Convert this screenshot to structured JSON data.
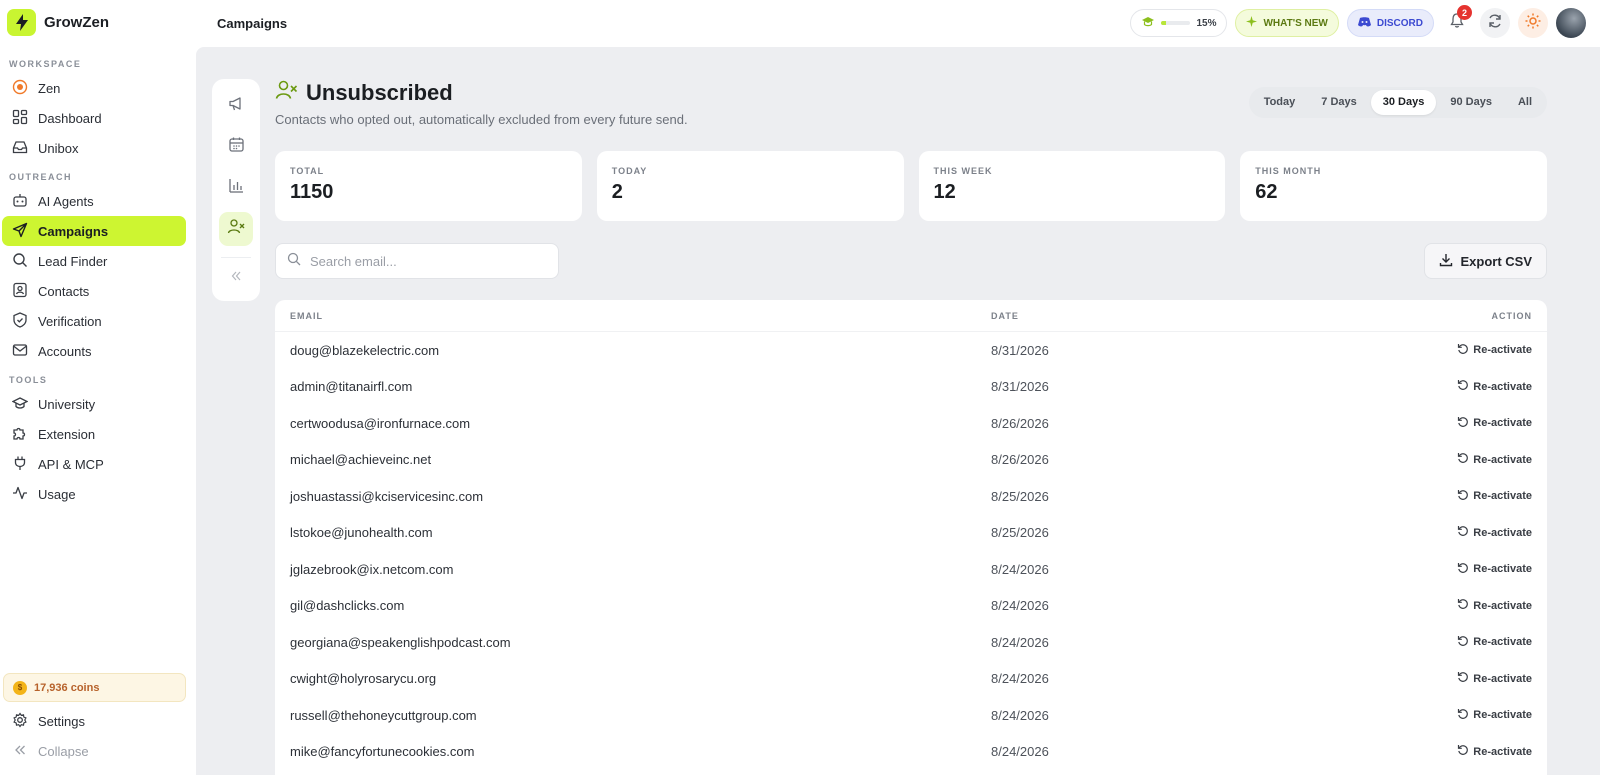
{
  "app": {
    "name": "GrowZen",
    "breadcrumb": "Campaigns"
  },
  "topbar": {
    "progress_label": "15%",
    "progress_value": 0.15,
    "whats_new_label": "WHAT'S NEW",
    "discord_label": "DISCORD",
    "notification_count": "2"
  },
  "sidebar": {
    "sections": {
      "workspace": "WORKSPACE",
      "outreach": "OUTREACH",
      "tools": "TOOLS"
    },
    "workspace_items": [
      {
        "label": "Zen",
        "icon": "target-icon"
      },
      {
        "label": "Dashboard",
        "icon": "grid-icon"
      },
      {
        "label": "Unibox",
        "icon": "inbox-icon"
      }
    ],
    "outreach_items": [
      {
        "label": "AI Agents",
        "icon": "bot-icon"
      },
      {
        "label": "Campaigns",
        "icon": "send-icon"
      },
      {
        "label": "Lead Finder",
        "icon": "search-icon"
      },
      {
        "label": "Contacts",
        "icon": "contacts-icon"
      },
      {
        "label": "Verification",
        "icon": "shield-check-icon"
      },
      {
        "label": "Accounts",
        "icon": "mail-icon"
      }
    ],
    "tools_items": [
      {
        "label": "University",
        "icon": "graduation-cap-icon"
      },
      {
        "label": "Extension",
        "icon": "puzzle-icon"
      },
      {
        "label": "API & MCP",
        "icon": "plug-icon"
      },
      {
        "label": "Usage",
        "icon": "activity-icon"
      }
    ],
    "coins": "17,936 coins",
    "settings": "Settings",
    "collapse": "Collapse"
  },
  "page": {
    "title": "Unsubscribed",
    "subtitle": "Contacts who opted out, automatically excluded from every future send.",
    "ranges": [
      "Today",
      "7 Days",
      "30 Days",
      "90 Days",
      "All"
    ],
    "active_range": "30 Days",
    "stats": [
      {
        "label": "TOTAL",
        "value": "1150"
      },
      {
        "label": "TODAY",
        "value": "2"
      },
      {
        "label": "THIS WEEK",
        "value": "12"
      },
      {
        "label": "THIS MONTH",
        "value": "62"
      }
    ],
    "search_placeholder": "Search email...",
    "export_label": "Export CSV",
    "table": {
      "headers": {
        "email": "EMAIL",
        "date": "DATE",
        "action": "ACTION"
      },
      "action_label": "Re-activate",
      "rows": [
        {
          "email": "doug@blazekelectric.com",
          "date": "8/31/2026"
        },
        {
          "email": "admin@titanairfl.com",
          "date": "8/31/2026"
        },
        {
          "email": "certwoodusa@ironfurnace.com",
          "date": "8/26/2026"
        },
        {
          "email": "michael@achieveinc.net",
          "date": "8/26/2026"
        },
        {
          "email": "joshuastassi@kciservicesinc.com",
          "date": "8/25/2026"
        },
        {
          "email": "lstokoe@junohealth.com",
          "date": "8/25/2026"
        },
        {
          "email": "jglazebrook@ix.netcom.com",
          "date": "8/24/2026"
        },
        {
          "email": "gil@dashclicks.com",
          "date": "8/24/2026"
        },
        {
          "email": "georgiana@speakenglishpodcast.com",
          "date": "8/24/2026"
        },
        {
          "email": "cwight@holyrosarycu.org",
          "date": "8/24/2026"
        },
        {
          "email": "russell@thehoneycuttgroup.com",
          "date": "8/24/2026"
        },
        {
          "email": "mike@fancyfortunecookies.com",
          "date": "8/24/2026"
        }
      ]
    }
  },
  "colors": {
    "accent": "#cdf531",
    "brand": "#c9f531",
    "badge": "#e5332f"
  }
}
